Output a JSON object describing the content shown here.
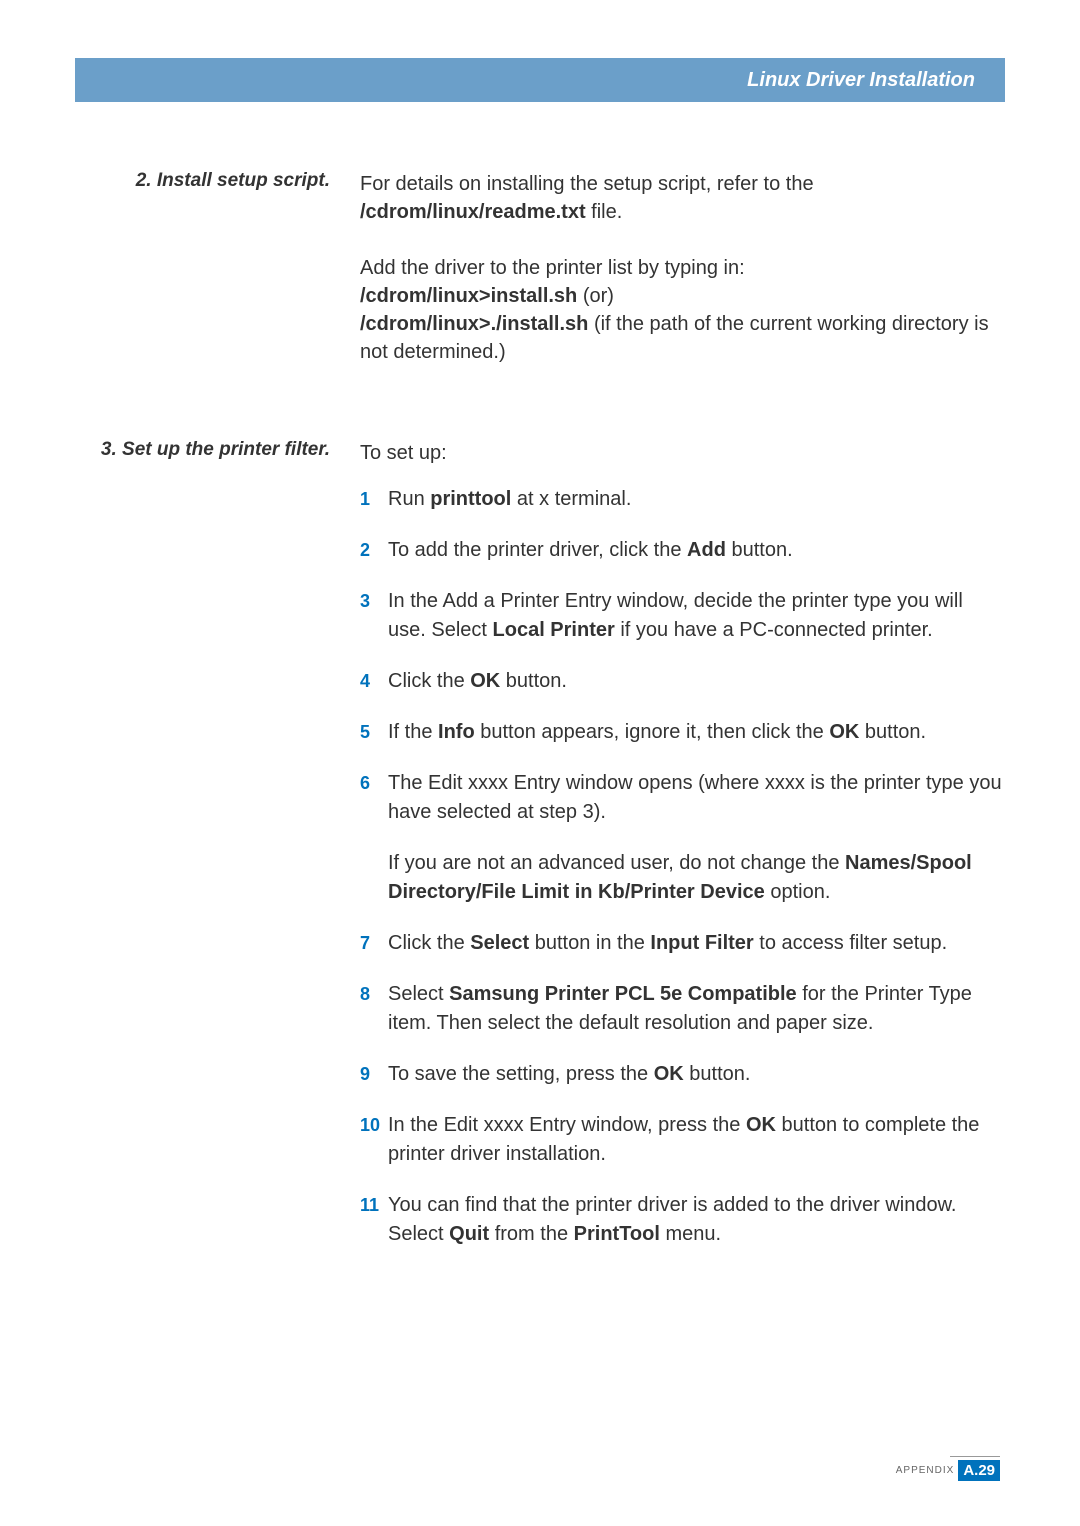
{
  "header": {
    "title": "Linux Driver Installation"
  },
  "section2": {
    "label": "2. Install setup script.",
    "para1_pre": "For details on installing the setup script, refer to the ",
    "para1_bold": "/cdrom/linux/readme.txt",
    "para1_post": " file.",
    "para2_line1": "Add the driver to the printer list by typing in:",
    "para2_bold1": "/cdrom/linux>install.sh",
    "para2_or": "   (or)",
    "para2_bold2": "/cdrom/linux>./install.sh",
    "para2_post": " (if the path of the current working directory is not determined.)"
  },
  "section3": {
    "label": "3. Set up the printer filter.",
    "intro": "To set up:",
    "steps": [
      {
        "num": "1",
        "parts": [
          {
            "t": "Run "
          },
          {
            "b": "printtool"
          },
          {
            "t": " at x terminal."
          }
        ]
      },
      {
        "num": "2",
        "parts": [
          {
            "t": "To add the printer driver, click the "
          },
          {
            "b": "Add"
          },
          {
            "t": " button."
          }
        ]
      },
      {
        "num": "3",
        "parts": [
          {
            "t": "In the Add a Printer Entry window, decide the printer type you will use. Select "
          },
          {
            "b": "Local Printer"
          },
          {
            "t": " if you have a PC-connected printer."
          }
        ]
      },
      {
        "num": "4",
        "parts": [
          {
            "t": "Click the "
          },
          {
            "b": "OK"
          },
          {
            "t": " button."
          }
        ]
      },
      {
        "num": "5",
        "parts": [
          {
            "t": "If the "
          },
          {
            "b": "Info"
          },
          {
            "t": " button appears, ignore it, then click the "
          },
          {
            "b": "OK"
          },
          {
            "t": " button."
          }
        ]
      },
      {
        "num": "6",
        "parts": [
          {
            "t": "The Edit xxxx Entry window opens (where xxxx is the printer type you have selected at step 3)."
          }
        ],
        "sub": [
          {
            "t": "If you are not an advanced user, do not change the "
          },
          {
            "b": "Names/Spool Directory/File Limit in Kb/Printer Device"
          },
          {
            "t": " option."
          }
        ]
      },
      {
        "num": "7",
        "parts": [
          {
            "t": "Click the "
          },
          {
            "b": "Select"
          },
          {
            "t": " button in the "
          },
          {
            "b": "Input Filter"
          },
          {
            "t": " to access filter setup."
          }
        ]
      },
      {
        "num": "8",
        "parts": [
          {
            "t": "Select "
          },
          {
            "b": "Samsung Printer PCL 5e Compatible"
          },
          {
            "t": " for the Printer Type item. Then select the default resolution and paper size."
          }
        ]
      },
      {
        "num": "9",
        "parts": [
          {
            "t": "To save the setting, press the "
          },
          {
            "b": "OK"
          },
          {
            "t": " button."
          }
        ]
      },
      {
        "num": "10",
        "parts": [
          {
            "t": "In the Edit xxxx Entry window, press the "
          },
          {
            "b": "OK"
          },
          {
            "t": " button to complete the printer driver installation."
          }
        ]
      },
      {
        "num": "11",
        "parts": [
          {
            "t": "You can find that the printer driver is added to the driver window. Select "
          },
          {
            "b": "Quit"
          },
          {
            "t": " from the "
          },
          {
            "b": "PrintTool"
          },
          {
            "t": " menu."
          }
        ]
      }
    ]
  },
  "footer": {
    "label": "APPENDIX",
    "page": "A.29"
  }
}
